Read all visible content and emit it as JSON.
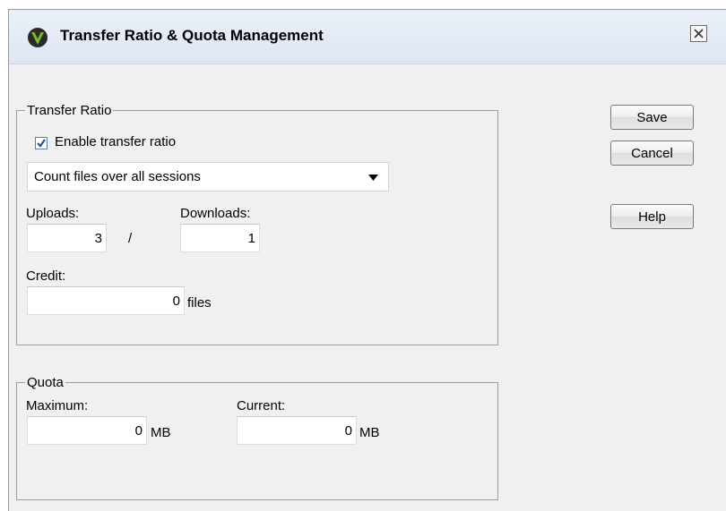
{
  "window": {
    "title": "Transfer Ratio & Quota Management",
    "app_icon": "v-logo-icon",
    "close_icon": "close-icon"
  },
  "transfer_ratio": {
    "legend": "Transfer Ratio",
    "enable_label": "Enable transfer ratio",
    "enable_checked": true,
    "mode_selected": "Count files over all sessions",
    "uploads_label": "Uploads:",
    "uploads_value": "3",
    "separator": "/",
    "downloads_label": "Downloads:",
    "downloads_value": "1",
    "credit_label": "Credit:",
    "credit_value": "0",
    "credit_unit": "files"
  },
  "quota": {
    "legend": "Quota",
    "maximum_label": "Maximum:",
    "maximum_value": "0",
    "maximum_unit": "MB",
    "current_label": "Current:",
    "current_value": "0",
    "current_unit": "MB"
  },
  "buttons": {
    "save": "Save",
    "cancel": "Cancel",
    "help": "Help"
  },
  "colors": {
    "accent_green": "#7ab829",
    "accent_dark": "#2b2b2b",
    "check_blue": "#2d4f8a"
  }
}
